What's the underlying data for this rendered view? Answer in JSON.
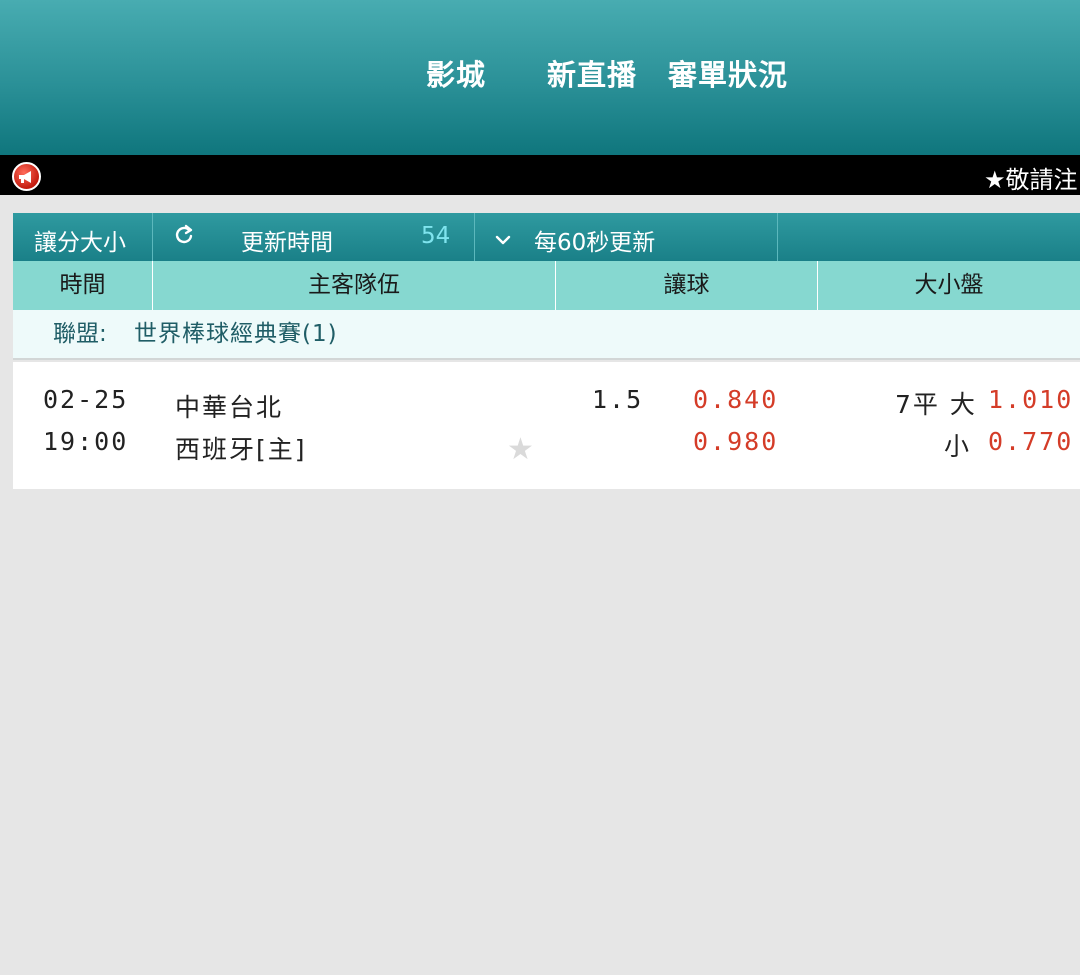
{
  "nav": {
    "items": [
      "影城",
      "新直播",
      "審單狀況"
    ]
  },
  "ticker": {
    "icon": "megaphone-icon",
    "text": "★敬請注"
  },
  "toolbar": {
    "mode_label": "讓分大小",
    "refresh_icon": "refresh-icon",
    "update_label": "更新時間",
    "countdown": "54",
    "dropdown_icon": "chevron-down-icon",
    "interval_label": "每60秒更新"
  },
  "columns": {
    "time": "時間",
    "teams": "主客隊伍",
    "handicap": "讓球",
    "overunder": "大小盤"
  },
  "league": {
    "label": "聯盟:",
    "name": "世界棒球經典賽(1)"
  },
  "match": {
    "date": "02-25",
    "time": "19:00",
    "team_away": "中華台北",
    "team_home": "西班牙[主]",
    "handicap_line": "1.5",
    "handicap_odds_1": "0.840",
    "handicap_odds_2": "0.980",
    "ou_line": "7平 大",
    "ou_over_odds": "1.010",
    "ou_under_label": "小",
    "ou_under_odds": "0.770"
  },
  "colors": {
    "header_teal": "#1a8088",
    "odds_red": "#d43c28",
    "countdown_cyan": "#7fe4ee",
    "column_header": "#86d8d0"
  }
}
